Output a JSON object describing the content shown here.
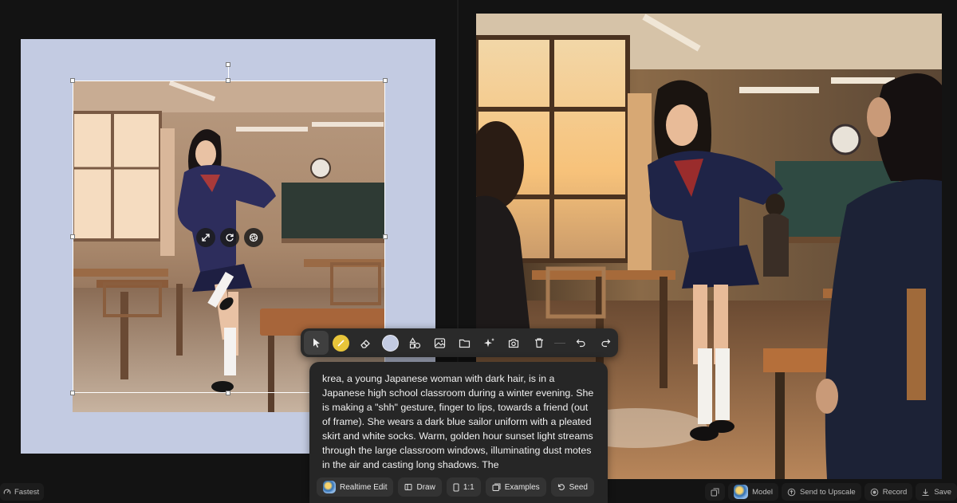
{
  "canvas": {
    "background_color": "#c3cbe2",
    "float_tools": [
      {
        "name": "scale",
        "icon": "expand-arrows-icon"
      },
      {
        "name": "rotate",
        "icon": "rotate-icon"
      },
      {
        "name": "remove-background",
        "icon": "aperture-icon"
      }
    ]
  },
  "toolbar": {
    "tools": [
      {
        "name": "select",
        "icon": "cursor-icon",
        "active": true
      },
      {
        "name": "brush",
        "icon": "brush-swatch-icon",
        "color": "#e8c53a"
      },
      {
        "name": "eraser",
        "icon": "eraser-icon"
      },
      {
        "name": "fill-color",
        "icon": "color-swatch-icon",
        "color": "#c3cbe2"
      },
      {
        "name": "shapes",
        "icon": "shapes-icon"
      },
      {
        "name": "image",
        "icon": "image-icon"
      },
      {
        "name": "folder",
        "icon": "folder-icon"
      },
      {
        "name": "ai-sparkle",
        "icon": "sparkles-icon"
      },
      {
        "name": "camera",
        "icon": "camera-plus-icon"
      },
      {
        "name": "delete",
        "icon": "trash-icon"
      },
      {
        "name": "undo",
        "icon": "undo-icon"
      },
      {
        "name": "redo",
        "icon": "redo-icon"
      }
    ]
  },
  "prompt": {
    "text": "krea, a young Japanese woman with dark hair,  is in a Japanese high school classroom during a winter evening. She is making a \"shh\" gesture, finger to lips, towards a friend (out of frame). She wears a dark blue sailor uniform with a pleated skirt and white socks. Warm, golden hour sunset light streams through the large classroom windows, illuminating dust motes in the air and casting long shadows. The"
  },
  "chips": {
    "realtime_edit": "Realtime Edit",
    "draw": "Draw",
    "aspect": "1:1",
    "examples": "Examples",
    "seed": "Seed"
  },
  "bottom": {
    "speed_label": "Fastest",
    "model_label": "Model",
    "upscale_label": "Send to Upscale",
    "record_label": "Record",
    "save_label": "Save"
  }
}
